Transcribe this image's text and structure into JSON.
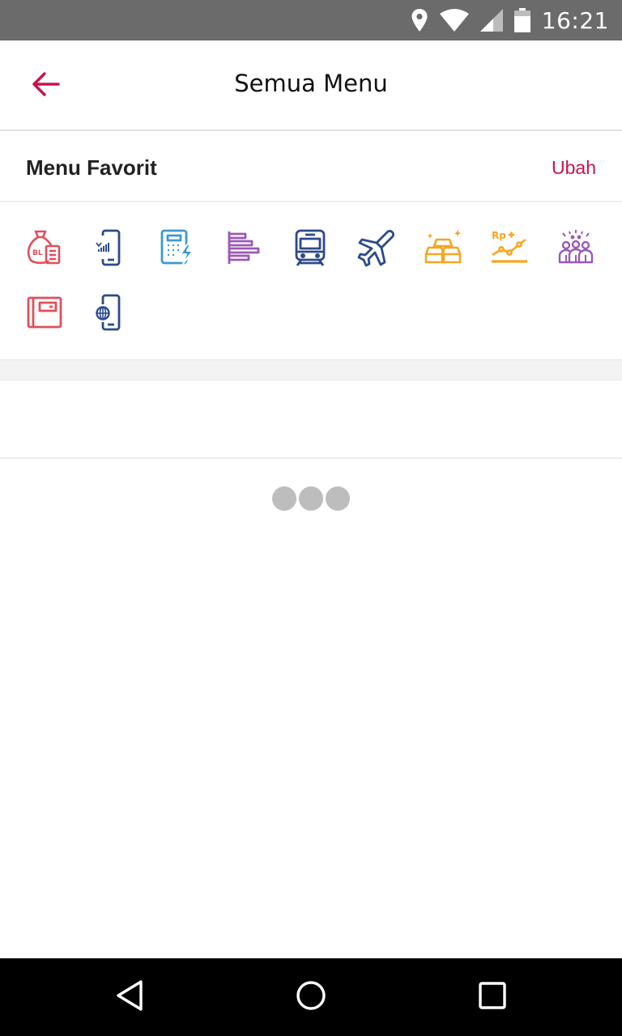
{
  "status_bar": {
    "time": "16:21",
    "icons": [
      "location-icon",
      "wifi-icon",
      "signal-icon",
      "battery-icon"
    ]
  },
  "header": {
    "title": "Semua Menu",
    "back_icon": "arrow-left-icon",
    "accent_color": "#c8134a"
  },
  "favorites": {
    "title": "Menu Favorit",
    "edit_label": "Ubah",
    "icons": [
      {
        "name": "bukalapak-bill-icon",
        "color": "#e0505b"
      },
      {
        "name": "phone-credit-icon",
        "color": "#2c4a8c"
      },
      {
        "name": "electricity-token-icon",
        "color": "#3d9ad1"
      },
      {
        "name": "list-menu-icon",
        "color": "#9b59b6"
      },
      {
        "name": "train-ticket-icon",
        "color": "#2c4a8c"
      },
      {
        "name": "flight-ticket-icon",
        "color": "#2c4a8c"
      },
      {
        "name": "gold-bars-icon",
        "color": "#f5a623"
      },
      {
        "name": "investment-chart-icon",
        "color": "#f5a623"
      },
      {
        "name": "donation-people-icon",
        "color": "#9b59b6"
      },
      {
        "name": "wallet-card-icon",
        "color": "#e0505b"
      },
      {
        "name": "internet-data-phone-icon",
        "color": "#2c4a8c"
      }
    ]
  },
  "loader": {
    "dots": 3,
    "color": "#bdbdbd"
  },
  "nav_bar": {
    "buttons": [
      "back-triangle-icon",
      "home-circle-icon",
      "recents-square-icon"
    ]
  }
}
